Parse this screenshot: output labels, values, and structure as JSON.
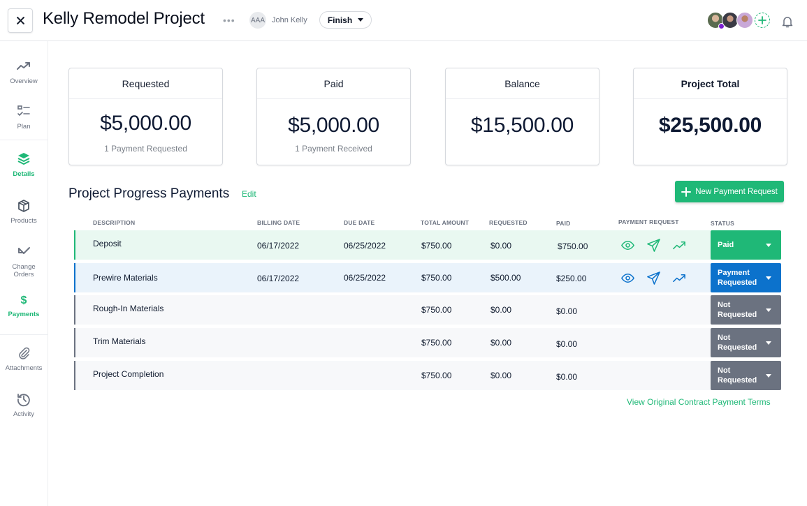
{
  "header": {
    "title": "Kelly Remodel Project",
    "more_label": "•••",
    "user": {
      "initials": "AAA",
      "name": "John Kelly"
    },
    "stage_select": {
      "value": "Finish"
    },
    "team": [
      {
        "name": "team-member-1",
        "online": true
      },
      {
        "name": "team-member-2",
        "online": false
      },
      {
        "name": "team-member-3",
        "online": false
      }
    ]
  },
  "sidebar": {
    "items": [
      {
        "label": "Overview",
        "icon": "trending-up-icon",
        "active": false
      },
      {
        "label": "Plan",
        "icon": "checklist-icon",
        "active": false
      },
      {
        "label": "Details",
        "icon": "layers-icon",
        "active": false
      },
      {
        "label": "Products",
        "icon": "box-icon",
        "active": false
      },
      {
        "label": "Change Orders",
        "icon": "arrow-down-left-check-icon",
        "active": false
      },
      {
        "label": "Payments",
        "icon": "dollar-icon",
        "active": true
      },
      {
        "label": "Attachments",
        "icon": "paperclip-icon",
        "active": false
      },
      {
        "label": "Activity",
        "icon": "history-icon",
        "active": false
      }
    ]
  },
  "summary": {
    "requested": {
      "title": "Requested",
      "amount": "$5,000.00",
      "sub": "1 Payment Requested"
    },
    "paid": {
      "title": "Paid",
      "amount": "$5,000.00",
      "sub": "1 Payment Received"
    },
    "balance": {
      "title": "Balance",
      "amount": "$15,500.00",
      "sub": ""
    },
    "total": {
      "title": "Project Total",
      "amount": "$25,500.00",
      "sub": ""
    }
  },
  "payments": {
    "title": "Project Progress Payments",
    "edit_label": "Edit",
    "new_button_label": "New Payment Request",
    "columns": [
      "DESCRIPTION",
      "BILLING DATE",
      "DUE DATE",
      "TOTAL AMOUNT",
      "REQUESTED",
      "PAID",
      "PAYMENT REQUEST",
      "STATUS"
    ],
    "rows": [
      {
        "description": "Deposit",
        "billing_date": "06/17/2022",
        "due_date": "06/25/2022",
        "total": "$750.00",
        "requested": "$0.00",
        "paid": "$750.00",
        "status": "Paid",
        "status_line1": "Paid",
        "status_line2": ""
      },
      {
        "description": "Prewire Materials",
        "billing_date": "06/17/2022",
        "due_date": "06/25/2022",
        "total": "$750.00",
        "requested": "$500.00",
        "paid": "$250.00",
        "status": "Payment Requested",
        "status_line1": "Payment",
        "status_line2": "Requested"
      },
      {
        "description": "Rough-In Materials",
        "billing_date": "",
        "due_date": "",
        "total": "$750.00",
        "requested": "$0.00",
        "paid": "$0.00",
        "status": "Not Requested",
        "status_line1": "Not",
        "status_line2": "Requested"
      },
      {
        "description": "Trim Materials",
        "billing_date": "",
        "due_date": "",
        "total": "$750.00",
        "requested": "$0.00",
        "paid": "$0.00",
        "status": "Not Requested",
        "status_line1": "Not",
        "status_line2": "Requested"
      },
      {
        "description": "Project Completion",
        "billing_date": "",
        "due_date": "",
        "total": "$750.00",
        "requested": "$0.00",
        "paid": "$0.00",
        "status": "Not Requested",
        "status_line1": "Not",
        "status_line2": "Requested"
      }
    ],
    "terms_link": "View Original Contract Payment Terms"
  },
  "colors": {
    "brand_green": "#1fb877",
    "requested_blue": "#0c72cc",
    "not_requested_gray": "#6b7280",
    "presence_purple": "#7b1fd1"
  }
}
